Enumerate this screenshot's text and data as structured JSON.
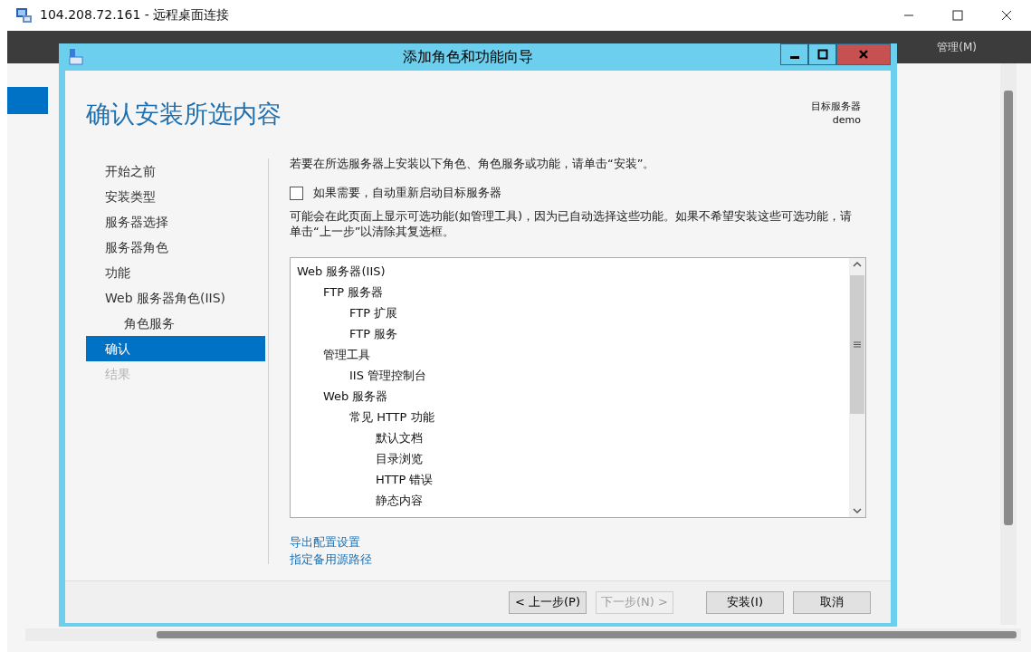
{
  "rdp_window": {
    "title": "104.208.72.161 - 远程桌面连接"
  },
  "server_manager": {
    "menu_item": "管理(M)"
  },
  "wizard": {
    "title": "添加角色和功能向导",
    "heading": "确认安装所选内容",
    "target_label": "目标服务器",
    "target_value": "demo",
    "nav": [
      {
        "label": "开始之前",
        "selected": false,
        "disabled": false
      },
      {
        "label": "安装类型",
        "selected": false,
        "disabled": false
      },
      {
        "label": "服务器选择",
        "selected": false,
        "disabled": false
      },
      {
        "label": "服务器角色",
        "selected": false,
        "disabled": false
      },
      {
        "label": "功能",
        "selected": false,
        "disabled": false
      },
      {
        "label": "Web 服务器角色(IIS)",
        "selected": false,
        "disabled": false,
        "children": [
          {
            "label": "角色服务",
            "selected": false,
            "disabled": false
          }
        ]
      },
      {
        "label": "确认",
        "selected": true,
        "disabled": false
      },
      {
        "label": "结果",
        "selected": false,
        "disabled": true
      }
    ],
    "intro": "若要在所选服务器上安装以下角色、角色服务或功能，请单击“安装”。",
    "restart_checkbox": {
      "label": "如果需要，自动重新启动目标服务器",
      "checked": false
    },
    "note": "可能会在此页面上显示可选功能(如管理工具)，因为已自动选择这些功能。如果不希望安装这些可选功能，请单击“上一步”以清除其复选框。",
    "features": [
      {
        "label": "Web 服务器(IIS)",
        "children": [
          {
            "label": "FTP 服务器",
            "children": [
              {
                "label": "FTP 扩展"
              },
              {
                "label": "FTP 服务"
              }
            ]
          },
          {
            "label": "管理工具",
            "children": [
              {
                "label": "IIS 管理控制台"
              }
            ]
          },
          {
            "label": "Web 服务器",
            "children": [
              {
                "label": "常见 HTTP 功能",
                "children": [
                  {
                    "label": "默认文档"
                  },
                  {
                    "label": "目录浏览"
                  },
                  {
                    "label": "HTTP 错误"
                  },
                  {
                    "label": "静态内容"
                  }
                ]
              }
            ]
          }
        ]
      }
    ],
    "links": [
      "导出配置设置",
      "指定备用源路径"
    ],
    "buttons": [
      {
        "label": "< 上一步(P)",
        "disabled": false
      },
      {
        "label": "下一步(N) >",
        "disabled": true
      },
      {
        "label": "安装(I)",
        "disabled": false
      },
      {
        "label": "取消",
        "disabled": false
      }
    ]
  }
}
